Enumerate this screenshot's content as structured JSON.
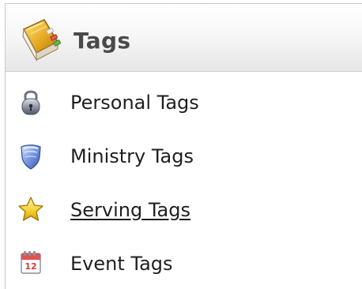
{
  "panel": {
    "title": "Tags",
    "title_icon": "address-book-icon",
    "items": [
      {
        "label": "Personal Tags",
        "icon": "lock-icon",
        "hovered": false
      },
      {
        "label": "Ministry Tags",
        "icon": "shield-icon",
        "hovered": false
      },
      {
        "label": "Serving Tags",
        "icon": "star-icon",
        "hovered": true
      },
      {
        "label": "Event Tags",
        "icon": "calendar-icon",
        "calendar_day": "12",
        "hovered": false
      }
    ]
  }
}
